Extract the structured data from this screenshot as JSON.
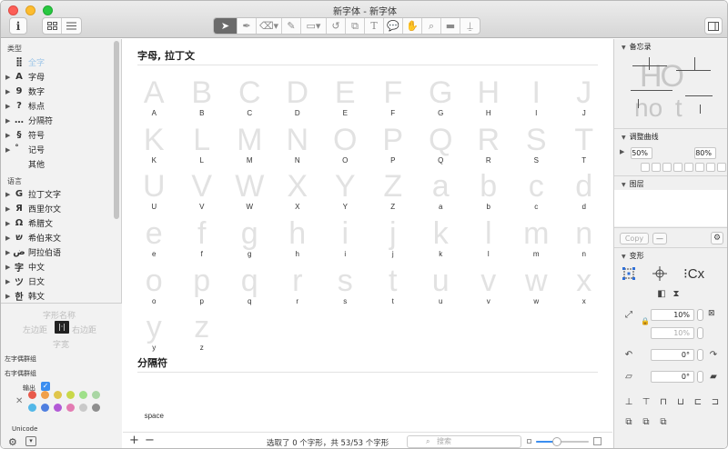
{
  "window": {
    "title": "新字体 - 新字体"
  },
  "toolbar": {
    "info_icon": "info-icon",
    "view_grid_icon": "grid-view-icon",
    "view_list_icon": "list-view-icon"
  },
  "sidebar": {
    "category_header": "类型",
    "categories": [
      {
        "icon": "⣿",
        "label": "全字",
        "selected": true
      },
      {
        "icon": "A",
        "label": "字母"
      },
      {
        "icon": "9",
        "label": "数字"
      },
      {
        "icon": "?",
        "label": "标点"
      },
      {
        "icon": "…",
        "label": "分隔符"
      },
      {
        "icon": "§",
        "label": "符号"
      },
      {
        "icon": "̊",
        "label": "记号"
      },
      {
        "icon": "",
        "label": "其他"
      }
    ],
    "language_header": "语言",
    "languages": [
      {
        "icon": "G",
        "label": "拉丁文字"
      },
      {
        "icon": "Я",
        "label": "西里尔文"
      },
      {
        "icon": "Ω",
        "label": "希腊文"
      },
      {
        "icon": "ש",
        "label": "希伯来文"
      },
      {
        "icon": "ض",
        "label": "阿拉伯语"
      },
      {
        "icon": "字",
        "label": "中文"
      },
      {
        "icon": "ツ",
        "label": "日文"
      },
      {
        "icon": "한",
        "label": "韩文"
      }
    ],
    "glyph_name_placeholder": "字形名称",
    "lsb_placeholder": "左边距",
    "rsb_placeholder": "右边距",
    "width_placeholder": "字宽",
    "left_group_label": "左字偶群组",
    "right_group_label": "右字偶群组",
    "export_label": "输出",
    "unicode_label": "Unicode",
    "colors": [
      "#e8594a",
      "#f0a04b",
      "#e0c64a",
      "#c9d84a",
      "#9fe08a",
      "#a9d6a4",
      "#53b8e8",
      "#4f7fe0",
      "#b25ad6",
      "#e37bb2",
      "#c9c9c9",
      "#8e8e8e"
    ]
  },
  "main": {
    "section_letters": "字母, 拉丁文",
    "glyphs": [
      "A",
      "B",
      "C",
      "D",
      "E",
      "F",
      "G",
      "H",
      "I",
      "J",
      "K",
      "L",
      "M",
      "N",
      "O",
      "P",
      "Q",
      "R",
      "S",
      "T",
      "U",
      "V",
      "W",
      "X",
      "Y",
      "Z",
      "a",
      "b",
      "c",
      "d",
      "e",
      "f",
      "g",
      "h",
      "i",
      "j",
      "k",
      "l",
      "m",
      "n",
      "o",
      "p",
      "q",
      "r",
      "s",
      "t",
      "u",
      "v",
      "w",
      "x",
      "y",
      "z"
    ],
    "section_separators": "分隔符",
    "separator_glyphs": [
      "space"
    ]
  },
  "bottom": {
    "status": "选取了 0 个字形，共 53/53 个字形",
    "search_placeholder": "搜索",
    "add_label": "+",
    "remove_label": "−",
    "zoom": 0.4
  },
  "rightpanel": {
    "memo_header": "备忘录",
    "memo_preview_upper": "HO",
    "memo_preview_lower": "no t",
    "curve_header": "调整曲线",
    "curve_min": "50%",
    "curve_max": "80%",
    "layers_header": "图层",
    "copy_label": "Copy",
    "transform_header": "变形",
    "scale_x": "10%",
    "scale_y": "10%",
    "rotate": "0°",
    "slant": "0°",
    "origin_label": "Cx"
  }
}
